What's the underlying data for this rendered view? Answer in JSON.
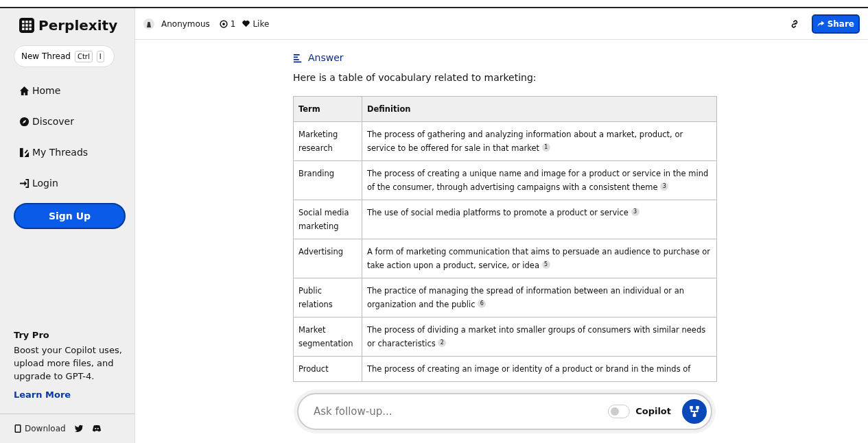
{
  "sidebar": {
    "brand": "Perplexity",
    "new_thread": {
      "label": "New Thread",
      "keys": [
        "Ctrl",
        "I"
      ]
    },
    "nav": [
      {
        "label": "Home"
      },
      {
        "label": "Discover"
      },
      {
        "label": "My Threads"
      },
      {
        "label": "Login"
      }
    ],
    "signup": "Sign Up",
    "promo": {
      "title": "Try Pro",
      "text": "Boost your Copilot uses, upload more files, and upgrade to GPT-4.",
      "link": "Learn More"
    },
    "footer": {
      "download": "Download"
    }
  },
  "header": {
    "author": "Anonymous",
    "views": "1",
    "like": "Like",
    "share": "Share"
  },
  "answer": {
    "heading": "Answer",
    "intro": "Here is a table of vocabulary related to marketing:",
    "columns": [
      "Term",
      "Definition"
    ],
    "rows": [
      {
        "term": "Marketing research",
        "definition": "The process of gathering and analyzing information about a market, product, or service to be offered for sale in that market $^{1}$"
      },
      {
        "term": "Branding",
        "definition": "The process of creating a unique name and image for a product or service in the mind of the consumer, through advertising campaigns with a consistent theme $^{3}$"
      },
      {
        "term": "Social media marketing",
        "definition": "The use of social media platforms to promote a product or service $^{3}$"
      },
      {
        "term": "Advertising",
        "definition": "A form of marketing communication that aims to persuade an audience to purchase or take action upon a product, service, or idea $^{5}$"
      },
      {
        "term": "Public relations",
        "definition": "The practice of managing the spread of information between an individual or an organization and the public $^{6}$"
      },
      {
        "term": "Market segmentation",
        "definition": "The process of dividing a market into smaller groups of consumers with similar needs or characteristics $^{2}$"
      },
      {
        "term": "Product",
        "definition": "The process of creating an image or identity of a product or brand in the minds of"
      }
    ]
  },
  "followup": {
    "placeholder": "Ask follow-up...",
    "copilot_label": "Copilot",
    "copilot_on": false
  }
}
